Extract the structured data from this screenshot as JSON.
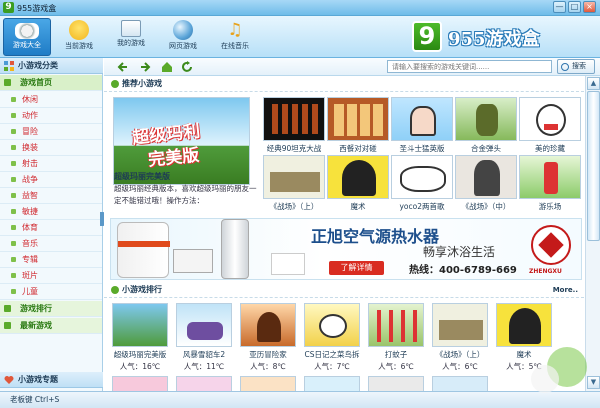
{
  "window": {
    "logo_text": "9",
    "title": "955游戏盒",
    "min_label": "—",
    "max_label": "□",
    "close_label": "×"
  },
  "toolbar": {
    "items": [
      {
        "label": "游戏大全",
        "icon": "gamepad-icon"
      },
      {
        "label": "当前游戏",
        "icon": "smiley-icon"
      },
      {
        "label": "我的游戏",
        "icon": "folder-add-icon"
      },
      {
        "label": "网页游戏",
        "icon": "globe-icon"
      },
      {
        "label": "在线音乐",
        "icon": "music-note-icon"
      }
    ]
  },
  "brand": {
    "nine": "9",
    "text": "955游戏盒"
  },
  "sidebar": {
    "header": "小游戏分类",
    "items": [
      "游戏首页",
      "休闲",
      "动作",
      "冒险",
      "换装",
      "射击",
      "战争",
      "益智",
      "敏捷",
      "体育",
      "音乐",
      "专辑",
      "斑片",
      "儿童"
    ],
    "group_rank": "游戏排行",
    "group_latest": "最新游戏",
    "footer_header": "小游戏专题"
  },
  "navbar": {
    "search_placeholder": "请输入要搜索的游戏关键词......",
    "search_button": "搜索"
  },
  "recommend": {
    "heading": "推荐小游戏",
    "featured_line1": "超级玛利",
    "featured_line2": "完美版",
    "featured_title": "超级玛丽完美版",
    "featured_desc": "超级玛丽经典版本，喜欢超级玛丽的朋友一定不能错过哦！操作方法：",
    "games": [
      "经典90坦克大战",
      "西餐对对碰",
      "圣斗士猛英版",
      "合金弹头",
      "美的珍藏",
      "《战场》（上）",
      "魔术",
      "yoco2两首歌",
      "《战场》（中）",
      "游乐场"
    ]
  },
  "banner": {
    "title": "正旭空气源热水器",
    "subtitle": "畅享沐浴生活",
    "button": "了解详情",
    "hotline": "热线：400-6789-669",
    "logo_text": "ZHENGXU"
  },
  "ranking": {
    "heading": "小游戏排行",
    "more": "More..",
    "games": [
      {
        "name": "超级玛丽完美版",
        "pop": "人气：16℃"
      },
      {
        "name": "风暴雪貂车2",
        "pop": "人气：11℃"
      },
      {
        "name": "亚历冒险家",
        "pop": "人气：8℃"
      },
      {
        "name": "CS日记之菜鸟拆",
        "pop": "人气：7℃"
      },
      {
        "name": "打蚊子",
        "pop": "人气：6℃"
      },
      {
        "name": "《战场》（上）",
        "pop": "人气：6℃"
      },
      {
        "name": "魔术",
        "pop": "人气：5℃"
      }
    ]
  },
  "statusbar": {
    "text": "老板键 Ctrl+S"
  },
  "colors": {
    "accent": "#1f7cc6",
    "green": "#5aaa2a",
    "red": "#d92c21"
  }
}
